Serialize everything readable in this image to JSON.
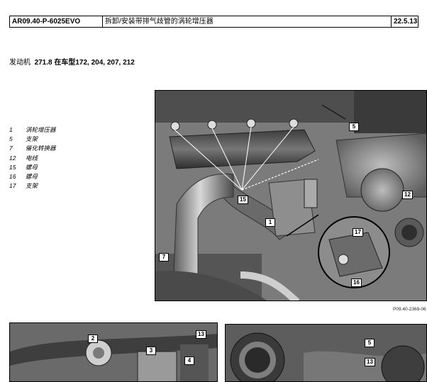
{
  "header": {
    "doc_code": "AR09.40-P-6025EVO",
    "title": "拆卸/安装带排气歧管的涡轮增压器",
    "date": "22.5.13"
  },
  "applicability": {
    "engine_label": "发动机",
    "engine_detail": "271.8 在车型172, 204, 207, 212"
  },
  "legend": [
    {
      "num": "1",
      "label": "涡轮增压器"
    },
    {
      "num": "5",
      "label": "支架"
    },
    {
      "num": "7",
      "label": "催化转换器"
    },
    {
      "num": "12",
      "label": "电线"
    },
    {
      "num": "15",
      "label": "螺母"
    },
    {
      "num": "16",
      "label": "螺母"
    },
    {
      "num": "17",
      "label": "支架"
    }
  ],
  "figure_ref": "P09.40-2369-06",
  "callouts_main": [
    "5",
    "12",
    "15",
    "1",
    "17",
    "7",
    "16"
  ],
  "callouts_bl": [
    "13",
    "2",
    "3",
    "4"
  ],
  "callouts_br": [
    "5",
    "13"
  ]
}
